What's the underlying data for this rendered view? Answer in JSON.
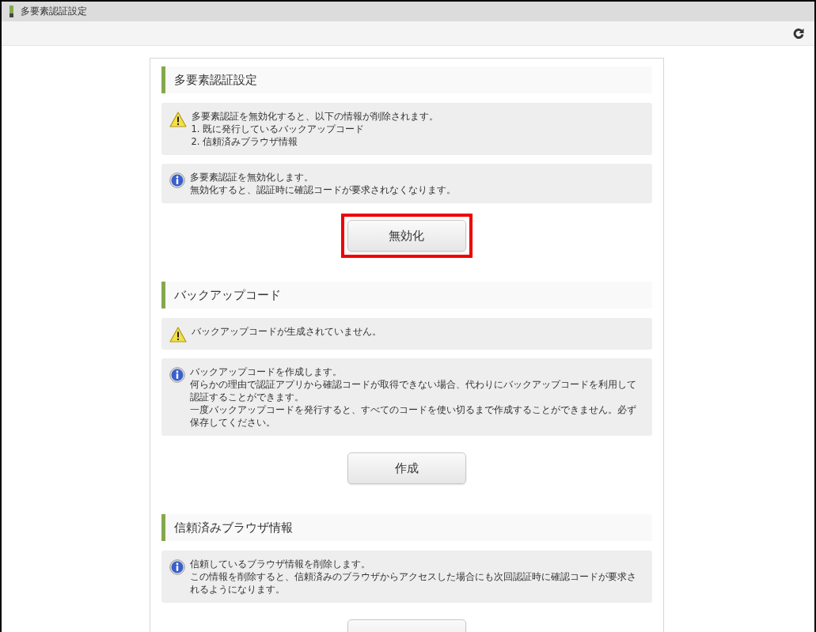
{
  "window": {
    "title": "多要素認証設定"
  },
  "sections": [
    {
      "title": "多要素認証設定",
      "messages": [
        {
          "kind": "warning",
          "lines": [
            "多要素認証を無効化すると、以下の情報が削除されます。",
            "1.  既に発行しているバックアップコード",
            "2.  信頼済みブラウザ情報"
          ]
        },
        {
          "kind": "info",
          "lines": [
            "多要素認証を無効化します。",
            "無効化すると、認証時に確認コードが要求されなくなります。"
          ]
        }
      ],
      "button": {
        "label": "無効化",
        "highlighted": true
      }
    },
    {
      "title": "バックアップコード",
      "messages": [
        {
          "kind": "warning",
          "lines": [
            "バックアップコードが生成されていません。"
          ]
        },
        {
          "kind": "info",
          "lines": [
            "バックアップコードを作成します。",
            "何らかの理由で認証アプリから確認コードが取得できない場合、代わりにバックアップコードを利用して認証することができます。",
            "一度バックアップコードを発行すると、すべてのコードを使い切るまで作成することができません。必ず保存してください。"
          ]
        }
      ],
      "button": {
        "label": "作成",
        "highlighted": false
      }
    },
    {
      "title": "信頼済みブラウザ情報",
      "messages": [
        {
          "kind": "info",
          "lines": [
            "信頼しているブラウザ情報を削除します。",
            "この情報を削除すると、信頼済みのブラウザからアクセスした場合にも次回認証時に確認コードが要求されるようになります。"
          ]
        }
      ],
      "button": {
        "highlighted": false
      }
    }
  ]
}
